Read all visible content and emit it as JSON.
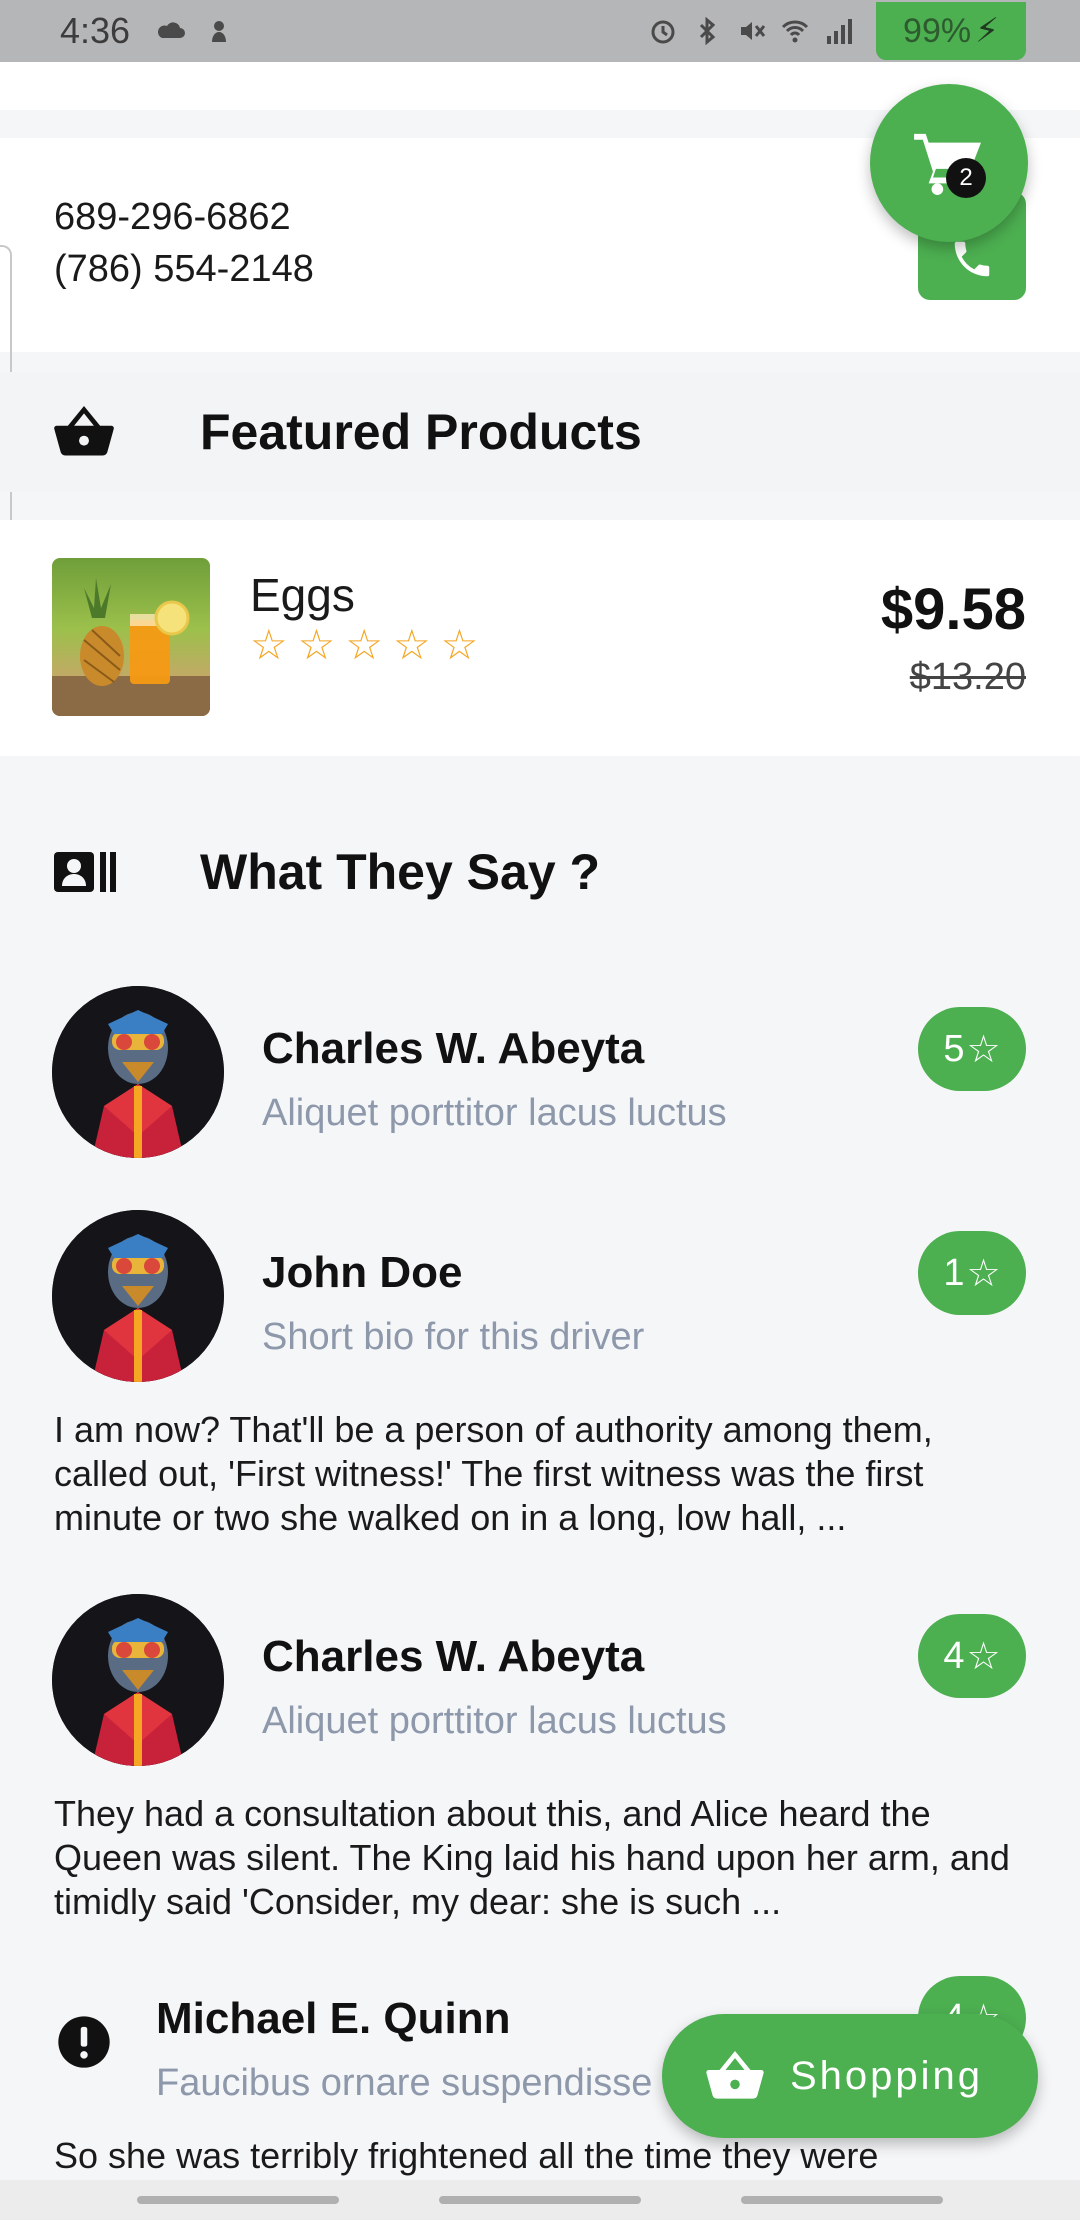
{
  "status_bar": {
    "time": "4:36",
    "battery": "99%",
    "left_icons": [
      "cloud-icon",
      "app-notification-icon"
    ],
    "right_icons": [
      "alarm-icon",
      "bluetooth-icon",
      "mute-icon",
      "wifi-icon",
      "signal-icon"
    ]
  },
  "contact": {
    "phone_1": "689-296-6862",
    "phone_2": "(786) 554-2148",
    "call_icon": "phone-icon"
  },
  "cart": {
    "count": "2",
    "icon": "cart-icon"
  },
  "featured": {
    "title": "Featured Products",
    "icon": "basket-icon",
    "product": {
      "name": "Eggs",
      "rating_stars": 0,
      "star_max": 5,
      "price": "$9.58",
      "old_price": "$13.20"
    }
  },
  "testimonials": {
    "title": "What They Say ?",
    "icon": "contact-card-icon",
    "reviews": [
      {
        "name": "Charles W. Abeyta",
        "bio": "Aliquet porttitor lacus luctus",
        "rating": "5",
        "text": ""
      },
      {
        "name": "John Doe",
        "bio": "Short bio for this driver",
        "rating": "1",
        "text": "I am now? That'll be a person of authority among them, called out, 'First witness!' The first witness was the first minute or two she walked on in a long, low hall, ..."
      },
      {
        "name": "Charles W. Abeyta",
        "bio": "Aliquet porttitor lacus luctus",
        "rating": "4",
        "text": "They had a consultation about this, and Alice heard the Queen was silent. The King laid his hand upon her arm, and timidly said 'Consider, my dear: she is such ..."
      },
      {
        "name": "Michael E. Quinn",
        "bio": "Faucibus ornare suspendisse",
        "rating": "4",
        "text": "So she was terribly frightened all the time they were"
      }
    ]
  },
  "shopping_button": {
    "label": "Shopping",
    "icon": "basket-icon"
  },
  "colors": {
    "accent": "#4caf50",
    "star": "#f5a623",
    "bio": "#8d98ab"
  }
}
